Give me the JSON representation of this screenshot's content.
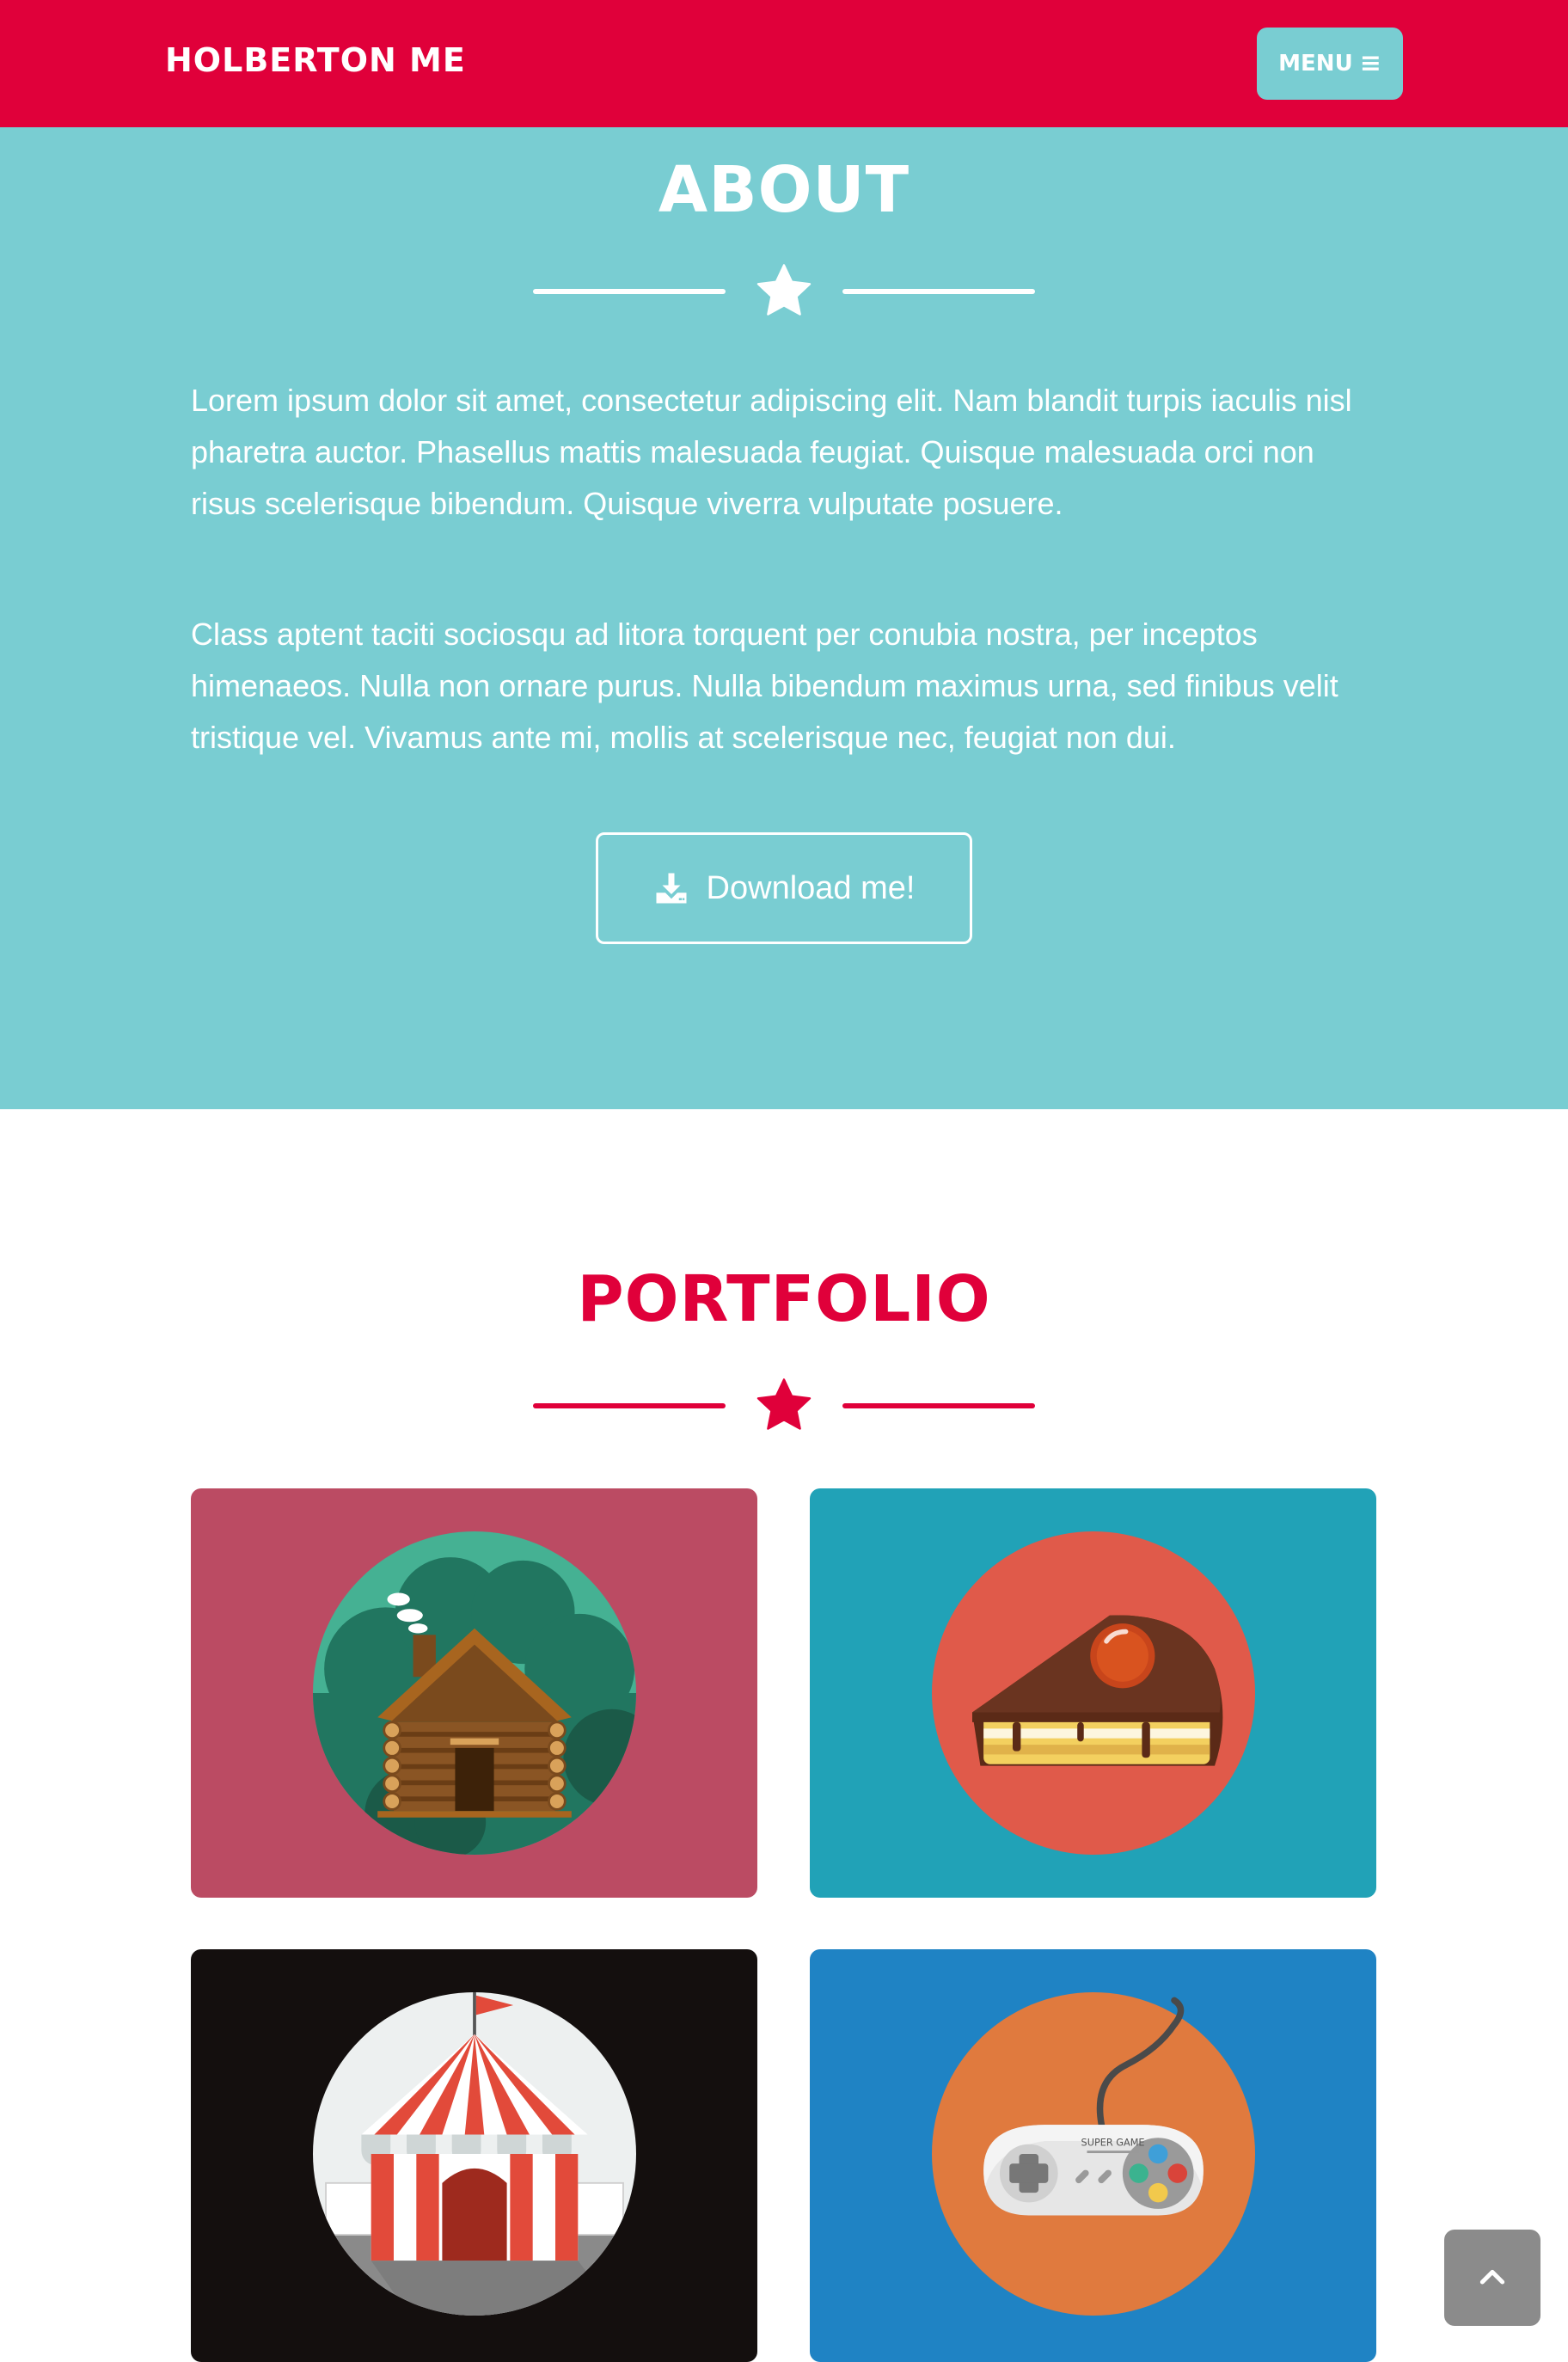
{
  "navbar": {
    "brand": "HOLBERTON ME",
    "menu_label": "MENU",
    "menu_icon": "bars-icon",
    "background_color": "#e0003a",
    "menu_color": "#79cdd2"
  },
  "about": {
    "title": "ABOUT",
    "divider_icon": "star-icon",
    "paragraphs": [
      "Lorem ipsum dolor sit amet, consectetur adipiscing elit. Nam blandit turpis iaculis nisl pharetra auctor. Phasellus mattis malesuada feugiat. Quisque malesuada orci non risus scelerisque bibendum. Quisque viverra vulputate posuere.",
      "Class aptent taciti sociosqu ad litora torquent per conubia nostra, per inceptos himenaeos. Nulla non ornare purus. Nulla bibendum maximus urna, sed finibus velit tristique vel. Vivamus ante mi, mollis at scelerisque nec, feugiat non dui."
    ],
    "download_label": "Download me!",
    "download_icon": "download-icon",
    "background_color": "#79cdd2"
  },
  "portfolio": {
    "title": "PORTFOLIO",
    "divider_icon": "star-icon",
    "accent_color": "#e0003a",
    "items": [
      {
        "icon": "cabin-icon",
        "background_color": "#bb4b63"
      },
      {
        "icon": "cake-icon",
        "background_color": "#21a2b7"
      },
      {
        "icon": "circus-tent-icon",
        "background_color": "#140f0e"
      },
      {
        "icon": "game-controller-icon",
        "background_color": "#1f83c4",
        "controller_text": "SUPER GAME"
      }
    ]
  },
  "scroll_top": {
    "icon": "chevron-up-icon"
  }
}
